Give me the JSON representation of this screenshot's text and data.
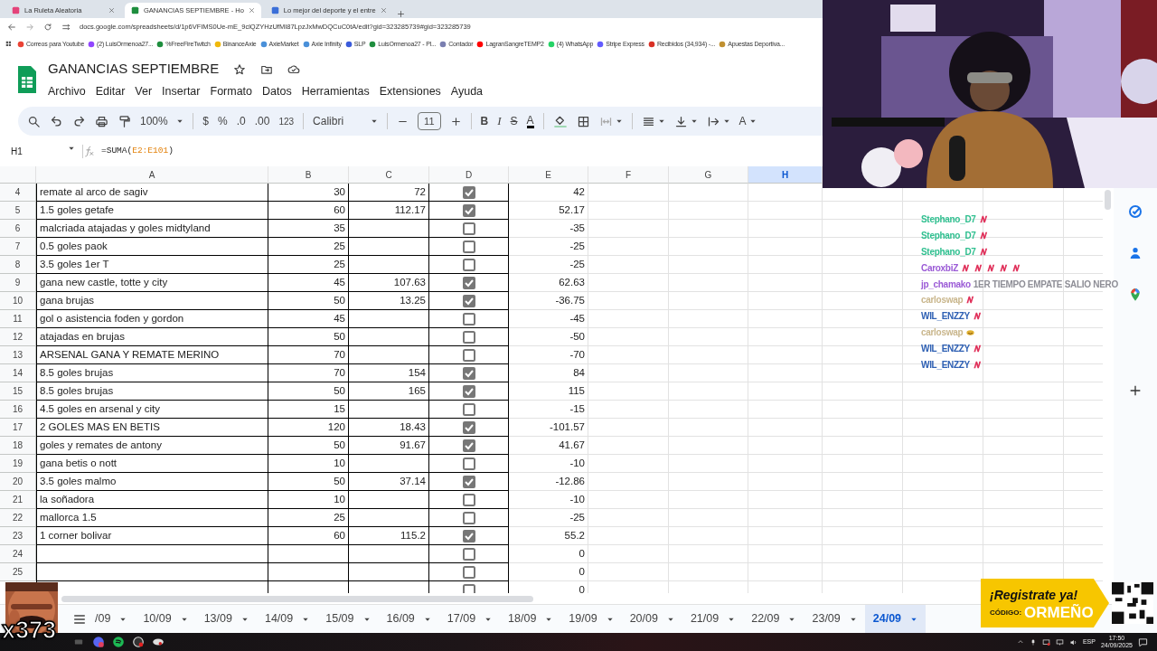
{
  "browser_tabs": [
    {
      "title": "La Ruleta Aleatoria",
      "selected": false
    },
    {
      "title": "GANANCIAS SEPTIEMBRE - Ho",
      "selected": true
    },
    {
      "title": "Lo mejor del deporte y el entre",
      "selected": false
    }
  ],
  "address": "docs.google.com/spreadsheets/d/1p6VFIMS0Ue-mE_9clQZYHzUfMI87LpzJxMwDQCuC0tA/edit?gid=323285739#gid=323285739",
  "bookmarks": [
    "Correos para Youtube",
    "(2) LuisOrmenoa27...",
    "%FreeFireTwitch",
    "BinanceAxie",
    "AxieMarket",
    "Axie Infinity",
    "SLP",
    "LuisOrmenoa27 - Pl...",
    "Contador",
    "LagranSangreTEMP2",
    "(4) WhatsApp",
    "Stripe Express",
    "Recibidos (34,934) -...",
    "Apuestas Deportiva..."
  ],
  "sheet": {
    "title": "GANANCIAS SEPTIEMBRE",
    "menu": [
      "Archivo",
      "Editar",
      "Ver",
      "Insertar",
      "Formato",
      "Datos",
      "Herramientas",
      "Extensiones",
      "Ayuda"
    ]
  },
  "toolbar": {
    "zoom": "100%",
    "currency": "$",
    "percent": "%",
    "decrease_decimals": ".0",
    "increase_decimals": ".00",
    "number_format": "123",
    "font": "Calibri",
    "font_size": "11",
    "bold": "B",
    "italic": "I",
    "strikethrough": "S",
    "text_color": "A",
    "text_rotation": "A"
  },
  "formula_bar": {
    "cell": "H1",
    "function": "=SUMA(",
    "range": "E2:E101",
    "close": ")"
  },
  "columns": [
    {
      "label": "A",
      "selected": false
    },
    {
      "label": "B",
      "selected": false
    },
    {
      "label": "C",
      "selected": false
    },
    {
      "label": "D",
      "selected": false
    },
    {
      "label": "E",
      "selected": false
    },
    {
      "label": "F",
      "selected": false
    },
    {
      "label": "G",
      "selected": false
    },
    {
      "label": "H",
      "selected": true
    }
  ],
  "rows": [
    {
      "number": "4",
      "A": "remate al arco de sagiv",
      "B": "30",
      "C": "72",
      "checked": true,
      "E": "42"
    },
    {
      "number": "5",
      "A": "1.5 goles getafe",
      "B": "60",
      "C": "112.17",
      "checked": true,
      "E": "52.17"
    },
    {
      "number": "6",
      "A": "malcriada atajadas y goles midtyland",
      "B": "35",
      "checked": false,
      "E": "-35"
    },
    {
      "number": "7",
      "A": "0.5 goles paok",
      "B": "25",
      "checked": false,
      "E": "-25"
    },
    {
      "number": "8",
      "A": "3.5 goles 1er T",
      "B": "25",
      "checked": false,
      "E": "-25"
    },
    {
      "number": "9",
      "A": "gana new castle, totte y city",
      "B": "45",
      "C": "107.63",
      "checked": true,
      "E": "62.63"
    },
    {
      "number": "10",
      "A": "gana brujas",
      "B": "50",
      "C": "13.25",
      "checked": true,
      "E": "-36.75"
    },
    {
      "number": "11",
      "A": "gol o asistencia foden y gordon",
      "B": "45",
      "checked": false,
      "E": "-45"
    },
    {
      "number": "12",
      "A": "atajadas en brujas",
      "B": "50",
      "checked": false,
      "E": "-50"
    },
    {
      "number": "13",
      "A": "ARSENAL GANA Y REMATE MERINO",
      "B": "70",
      "checked": false,
      "E": "-70"
    },
    {
      "number": "14",
      "A": "8.5 goles brujas",
      "B": "70",
      "C": "154",
      "checked": true,
      "E": "84"
    },
    {
      "number": "15",
      "A": "8.5 goles brujas",
      "B": "50",
      "C": "165",
      "checked": true,
      "E": "115"
    },
    {
      "number": "16",
      "A": "4.5 goles en arsenal y city",
      "B": "15",
      "checked": false,
      "E": "-15"
    },
    {
      "number": "17",
      "A": "2 GOLES MAS EN BETIS",
      "B": "120",
      "C": "18.43",
      "checked": true,
      "E": "-101.57"
    },
    {
      "number": "18",
      "A": "goles y remates de antony",
      "B": "50",
      "C": "91.67",
      "checked": true,
      "E": "41.67"
    },
    {
      "number": "19",
      "A": "gana betis o nott",
      "B": "10",
      "checked": false,
      "E": "-10"
    },
    {
      "number": "20",
      "A": "3.5 goles malmo",
      "B": "50",
      "C": "37.14",
      "checked": true,
      "E": "-12.86"
    },
    {
      "number": "21",
      "A": "la soñadora",
      "B": "10",
      "checked": false,
      "E": "-10"
    },
    {
      "number": "22",
      "A": "mallorca 1.5",
      "B": "25",
      "checked": false,
      "E": "-25"
    },
    {
      "number": "23",
      "A": "1 corner bolivar",
      "B": "60",
      "C": "115.2",
      "checked": true,
      "E": "55.2"
    },
    {
      "number": "24",
      "checked": false,
      "E": "0"
    },
    {
      "number": "25",
      "checked": false,
      "E": "0"
    },
    {
      "checked": false,
      "E": "0"
    }
  ],
  "sheet_tabs": [
    {
      "label": "/09",
      "selected": false
    },
    {
      "label": "10/09",
      "selected": false
    },
    {
      "label": "13/09",
      "selected": false
    },
    {
      "label": "14/09",
      "selected": false
    },
    {
      "label": "15/09",
      "selected": false
    },
    {
      "label": "16/09",
      "selected": false
    },
    {
      "label": "17/09",
      "selected": false
    },
    {
      "label": "18/09",
      "selected": false
    },
    {
      "label": "19/09",
      "selected": false
    },
    {
      "label": "20/09",
      "selected": false
    },
    {
      "label": "21/09",
      "selected": false
    },
    {
      "label": "22/09",
      "selected": false
    },
    {
      "label": "23/09",
      "selected": false
    },
    {
      "label": "24/09",
      "selected": true
    }
  ],
  "chat": [
    {
      "user": "Stephano_D7",
      "color": "#2fbf8f",
      "emotes": [
        {
          "kind": "sticker"
        }
      ]
    },
    {
      "user": "Stephano_D7",
      "color": "#2fbf8f",
      "emotes": [
        {
          "kind": "sticker"
        }
      ]
    },
    {
      "user": "Stephano_D7",
      "color": "#2fbf8f",
      "emotes": [
        {
          "kind": "sticker"
        }
      ]
    },
    {
      "user": "CaroxbiZ",
      "color": "#9b5bd6",
      "emotes": [
        {
          "kind": "sticker"
        },
        {
          "kind": "sticker"
        },
        {
          "kind": "sticker"
        },
        {
          "kind": "sticker"
        },
        {
          "kind": "sticker"
        }
      ]
    },
    {
      "user": "jp_chamako",
      "color": "#9b5bd6",
      "message": "1ER TIEMPO EMPATE SALIO NERO"
    },
    {
      "user": "carloswap",
      "color": "#c9b68c",
      "emotes": [
        {
          "kind": "sticker"
        }
      ]
    },
    {
      "user": "WIL_ENZZY",
      "color": "#2d5fb3",
      "emotes": [
        {
          "kind": "sticker"
        }
      ]
    },
    {
      "user": "carloswap",
      "color": "#c9b68c",
      "emotes": [
        {
          "kind": "smile"
        }
      ]
    },
    {
      "user": "WIL_ENZZY",
      "color": "#2d5fb3",
      "emotes": [
        {
          "kind": "sticker"
        }
      ]
    },
    {
      "user": "WIL_ENZZY",
      "color": "#2d5fb3",
      "emotes": [
        {
          "kind": "sticker"
        }
      ]
    }
  ],
  "promo": {
    "headline": "¡Registrate ya!",
    "code_label": "CÓDIGO:",
    "code": "ORMEÑO"
  },
  "meme": {
    "caption": "x373"
  },
  "taskbar": {
    "language": "ESP",
    "time": "17:50",
    "date": "24/09/2025"
  }
}
